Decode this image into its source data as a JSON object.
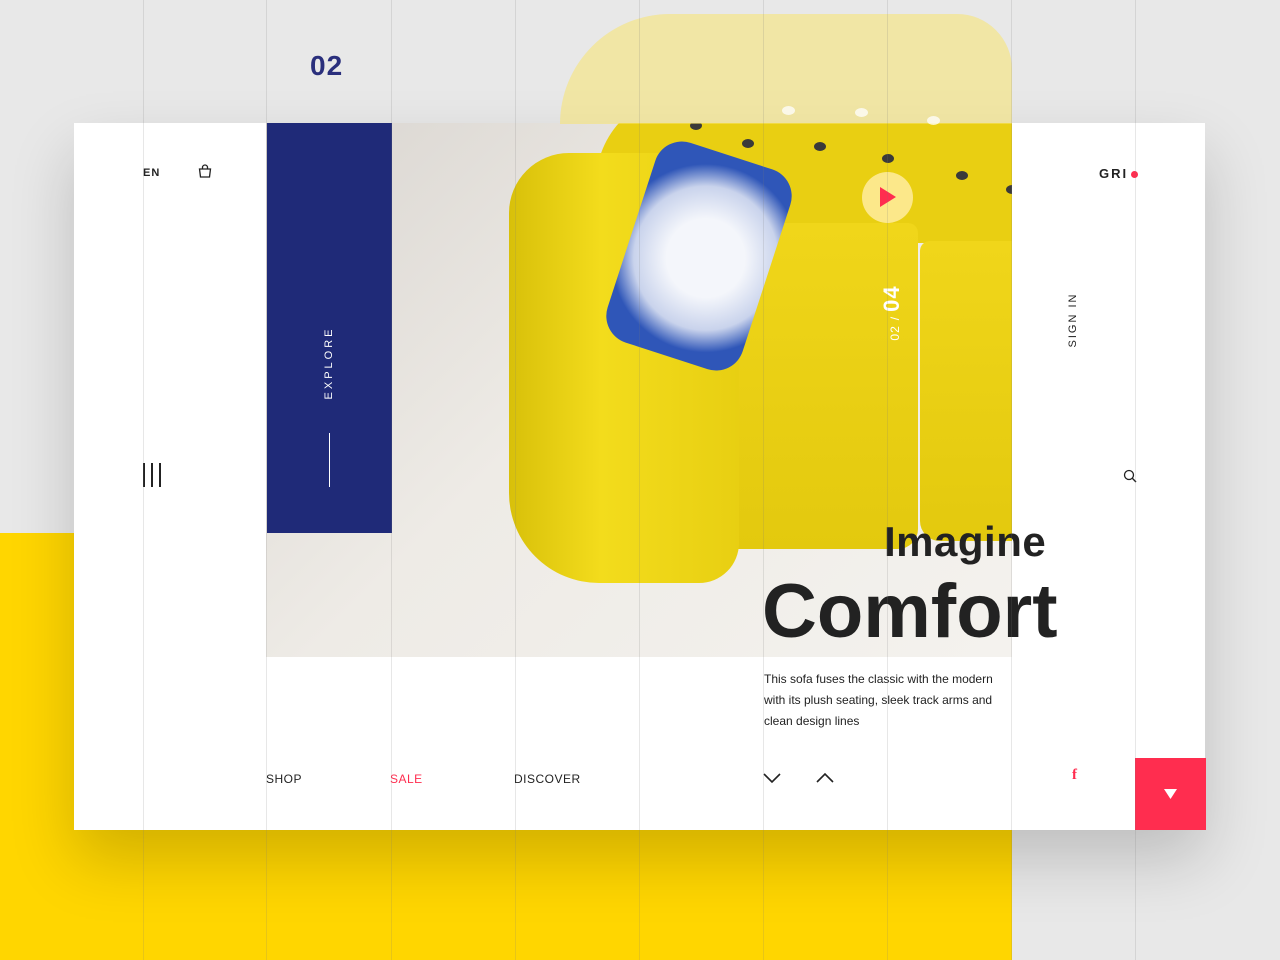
{
  "page_number": "02",
  "header": {
    "language": "EN",
    "logo_text": "GRI",
    "sign_in": "SIGN IN",
    "cart_icon": "shopping-bag-icon",
    "search_icon": "search-icon",
    "menu_icon": "hamburger-menu-icon"
  },
  "side_panel": {
    "label": "EXPLORE"
  },
  "slider": {
    "current": "02",
    "separator": "/",
    "total": "04",
    "play_icon": "play-icon"
  },
  "hero": {
    "title_line1": "Imagine",
    "title_line2": "Comfort",
    "description": "This sofa fuses the classic with the modern with its plush seating, sleek track arms and clean design lines"
  },
  "nav": {
    "shop": "SHOP",
    "sale": "SALE",
    "discover": "DISCOVER"
  },
  "controls": {
    "prev_icon": "chevron-down-icon",
    "next_icon": "chevron-up-icon",
    "facebook": "f",
    "scroll_icon": "triangle-down-icon"
  },
  "colors": {
    "brand_blue": "#1f2a78",
    "accent_red": "#ff2d4f",
    "accent_yellow": "#ffd600"
  }
}
